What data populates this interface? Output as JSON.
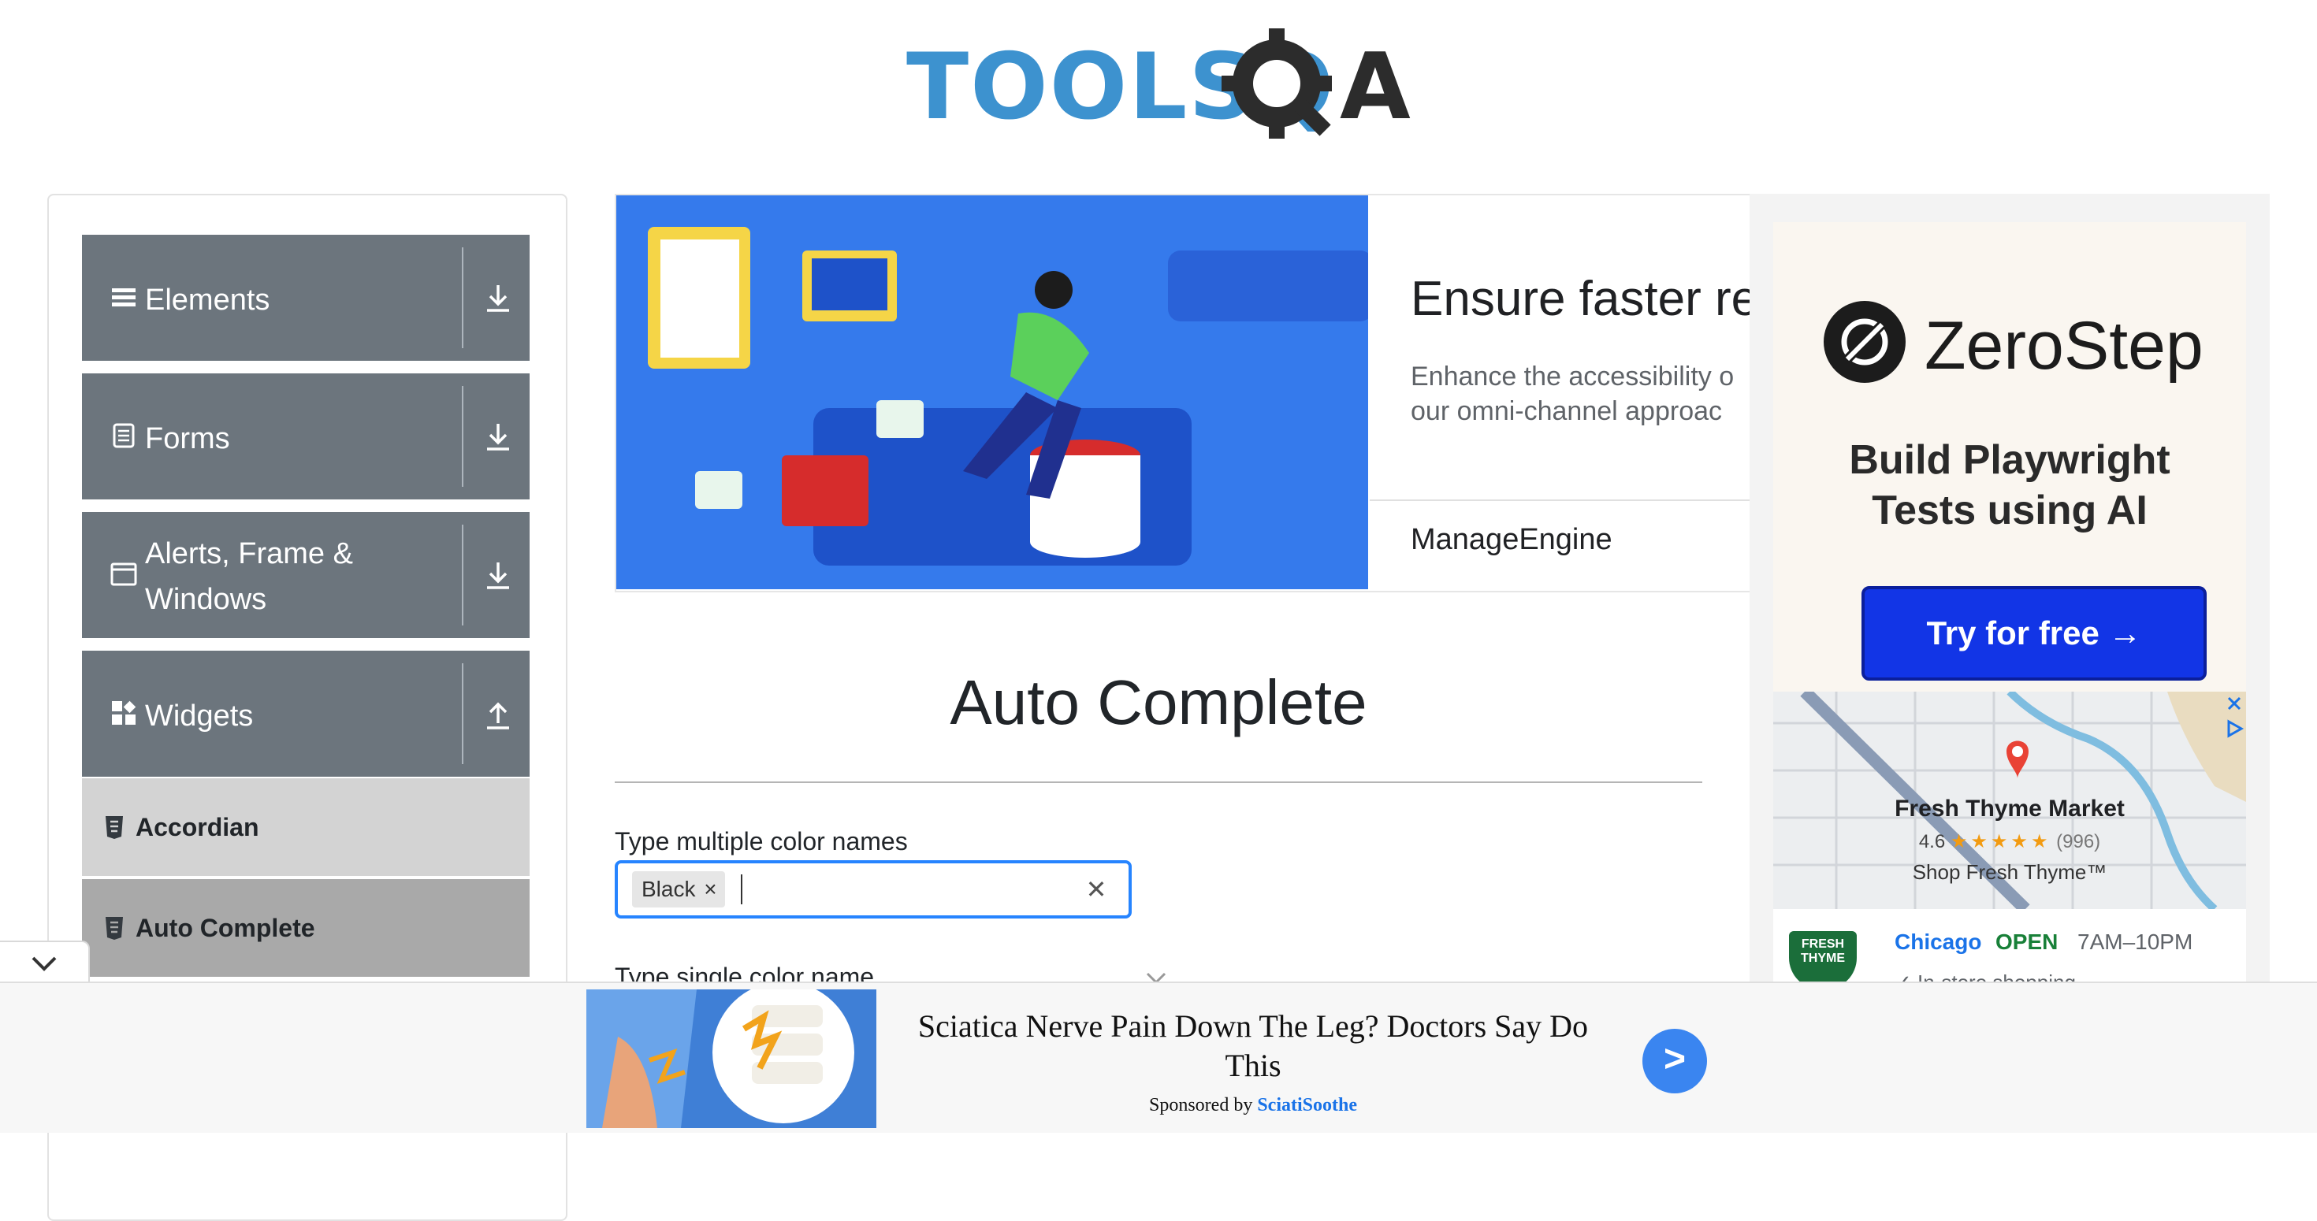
{
  "logo": {
    "text": "TOOLSQ",
    "text_a": "A"
  },
  "sidebar": {
    "groups": [
      {
        "label": "Elements",
        "icon": "list-icon",
        "arrow": "download-icon"
      },
      {
        "label": "Forms",
        "icon": "document-icon",
        "arrow": "download-icon"
      },
      {
        "label_line1": "Alerts, Frame &",
        "label_line2": "Windows",
        "icon": "window-icon",
        "arrow": "download-icon"
      },
      {
        "label": "Widgets",
        "icon": "widgets-icon",
        "arrow": "upload-icon"
      }
    ],
    "subitems": [
      {
        "label": "Accordian",
        "icon": "html5-icon"
      },
      {
        "label": "Auto Complete",
        "icon": "html5-icon"
      }
    ]
  },
  "top_ad": {
    "headline": "Ensure faster res",
    "description_line1": "Enhance the accessibility o",
    "description_line2": "our omni-channel approac",
    "brand": "ManageEngine"
  },
  "right_ad": {
    "brand": "ZeroStep",
    "tagline_line1": "Build Playwright",
    "tagline_line2": "Tests using AI",
    "cta": "Try for free →",
    "map": {
      "place": "Fresh Thyme Market",
      "rating": "4.6",
      "stars": "★★★★★",
      "reviews": "(996)",
      "subtitle": "Shop Fresh Thyme™"
    },
    "store": {
      "logo_text": "FRESH THYME",
      "city": "Chicago",
      "status": "OPEN",
      "hours": "7AM–10PM",
      "feature": "✓ In-store shopping"
    }
  },
  "main": {
    "title": "Auto Complete",
    "multi_label": "Type multiple color names",
    "chips": [
      {
        "label": "Black"
      }
    ],
    "single_label": "Type single color name"
  },
  "bottom_ad": {
    "headline": "Sciatica Nerve Pain Down The Leg? Doctors Say Do This",
    "sponsored_prefix": "Sponsored by",
    "sponsor": "SciatiSoothe",
    "button": ">"
  },
  "colors": {
    "sidebar_group": "#6c757d",
    "accent_blue": "#2684ff",
    "logo_blue": "#3d92cf",
    "cta_blue": "#1235e6"
  }
}
